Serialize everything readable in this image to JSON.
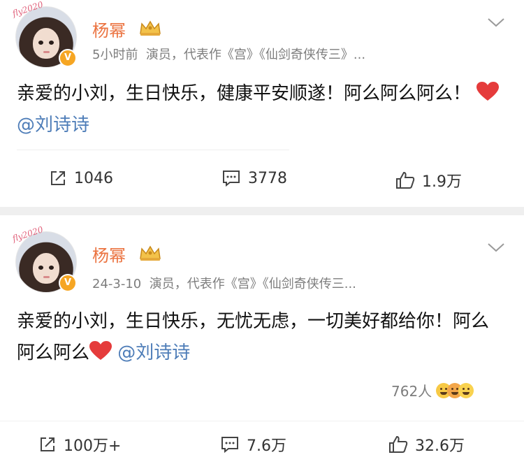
{
  "colors": {
    "username": "#eb7340",
    "mention": "#4e7db8",
    "heart": "#e53b3b",
    "meta": "#7d7d7d",
    "separator": "#efefef"
  },
  "posts": [
    {
      "user": "杨幂",
      "avatar_sticker": "fly2020",
      "verified_badge": "V",
      "time": "5小时前",
      "bio": "演员，代表作《宫》《仙剑奇侠传三》...",
      "text": "亲爱的小刘，生日快乐，健康平安顺遂！阿么阿么阿么！",
      "mention": "@刘诗诗",
      "reposts": "1046",
      "comments": "3778",
      "likes": "1.9万"
    },
    {
      "user": "杨幂",
      "avatar_sticker": "fly2020",
      "verified_badge": "V",
      "time": "24-3-10",
      "bio": "演员，代表作《宫》《仙剑奇侠传三...",
      "text": "亲爱的小刘，生日快乐，无忧无虑，一切美好都给你！阿么阿么阿么",
      "mention": "@刘诗诗",
      "reaction_count": "762人",
      "reposts": "100万+",
      "comments": "7.6万",
      "likes": "32.6万"
    }
  ],
  "icons": [
    "repost-icon",
    "comment-icon",
    "like-icon",
    "chevron-down-icon",
    "crown-icon",
    "heart-icon",
    "verified-badge-icon"
  ]
}
